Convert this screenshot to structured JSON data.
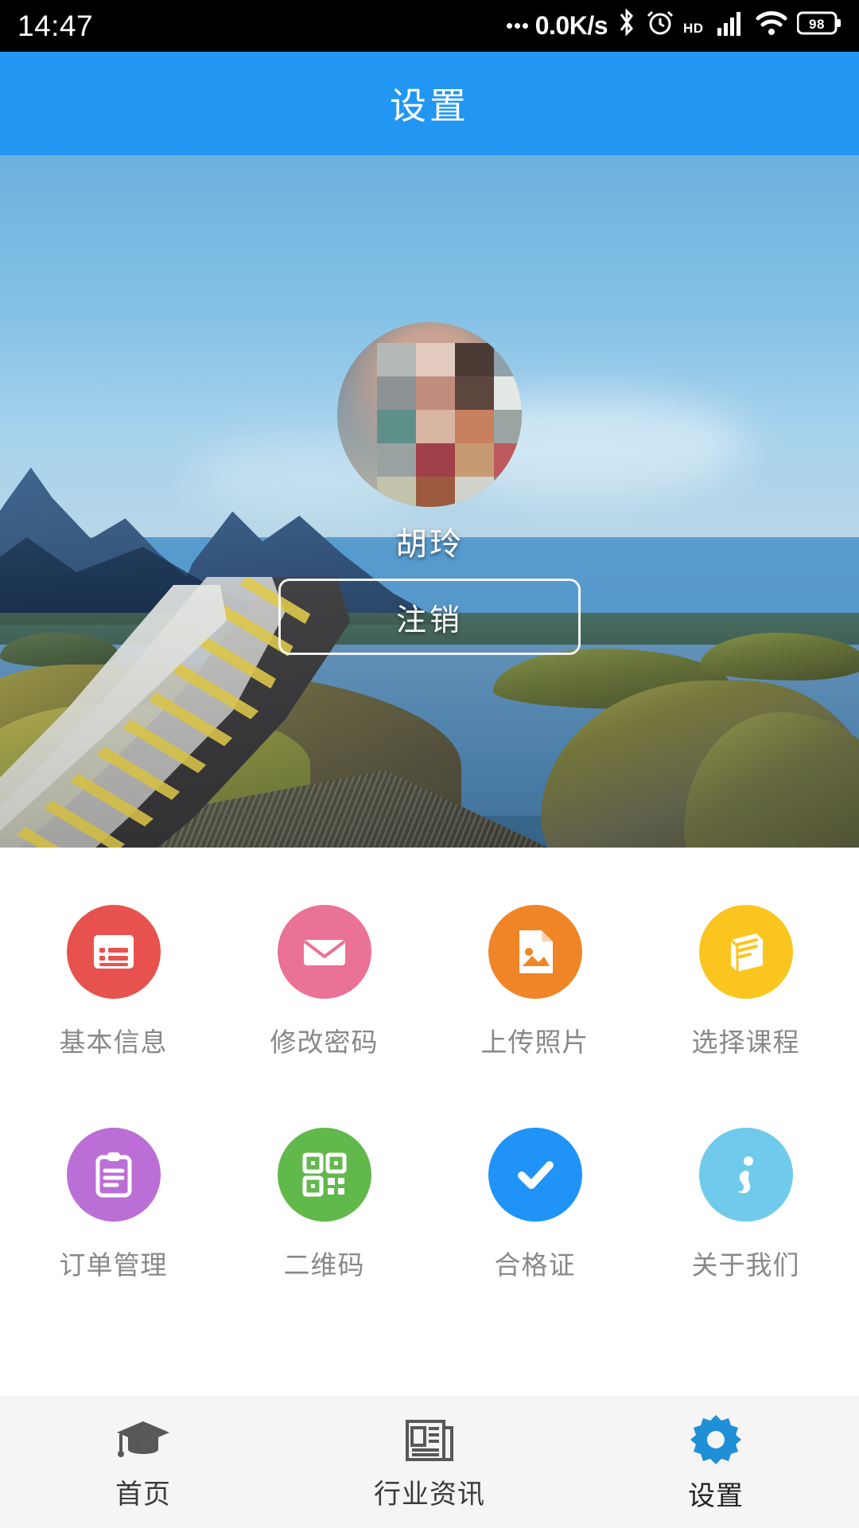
{
  "status_bar": {
    "time": "14:47",
    "network_speed": "0.0K/s",
    "battery_level": "98",
    "icons": [
      "ellipsis-icon",
      "bluetooth-icon",
      "alarm-icon",
      "hd-icon",
      "cellular-signal-icon",
      "wifi-icon",
      "battery-icon"
    ]
  },
  "header": {
    "title": "设置"
  },
  "profile": {
    "name": "胡玲",
    "logout_label": "注销",
    "avatar_icon": "user-avatar",
    "mosaic_colors": [
      "#b4b9b7",
      "#e3ccbf",
      "#4b3b34",
      "#8fa1a8",
      "#8d9296",
      "#c08c7e",
      "#5d463e",
      "#e4e9e6",
      "#5f8f89",
      "#d9b5a4",
      "#c9805f",
      "#9aa5a3",
      "#9aa2a1",
      "#a2404a",
      "#c79b72",
      "#bd5a5f",
      "#c3c2ab",
      "#9c5b3f",
      "#d2d2cc",
      "#7b8a6e"
    ]
  },
  "menu": {
    "rows": [
      [
        {
          "label": "基本信息",
          "icon": "list-form-icon",
          "color": "#e8524e"
        },
        {
          "label": "修改密码",
          "icon": "envelope-icon",
          "color": "#ea7296"
        },
        {
          "label": "上传照片",
          "icon": "photo-file-icon",
          "color": "#ef8527"
        },
        {
          "label": "选择课程",
          "icon": "book-icon",
          "color": "#fbc51f"
        }
      ],
      [
        {
          "label": "订单管理",
          "icon": "clipboard-icon",
          "color": "#bb6fd6"
        },
        {
          "label": "二维码",
          "icon": "qrcode-icon",
          "color": "#61b94c"
        },
        {
          "label": "合格证",
          "icon": "check-circle-icon",
          "color": "#1f93f7"
        },
        {
          "label": "关于我们",
          "icon": "info-icon",
          "color": "#6fcaec"
        }
      ]
    ]
  },
  "bottom_nav": {
    "items": [
      {
        "label": "首页",
        "icon": "graduation-cap-icon",
        "active": false
      },
      {
        "label": "行业资讯",
        "icon": "newspaper-icon",
        "active": false
      },
      {
        "label": "设置",
        "icon": "gear-icon",
        "active": true
      }
    ],
    "active_color": "#1f8fd6",
    "inactive_color": "#58585a"
  },
  "colors": {
    "header_blue": "#2196f3",
    "page_background": "#ffffff",
    "nav_background": "#f5f5f5",
    "label_gray": "#888888"
  }
}
